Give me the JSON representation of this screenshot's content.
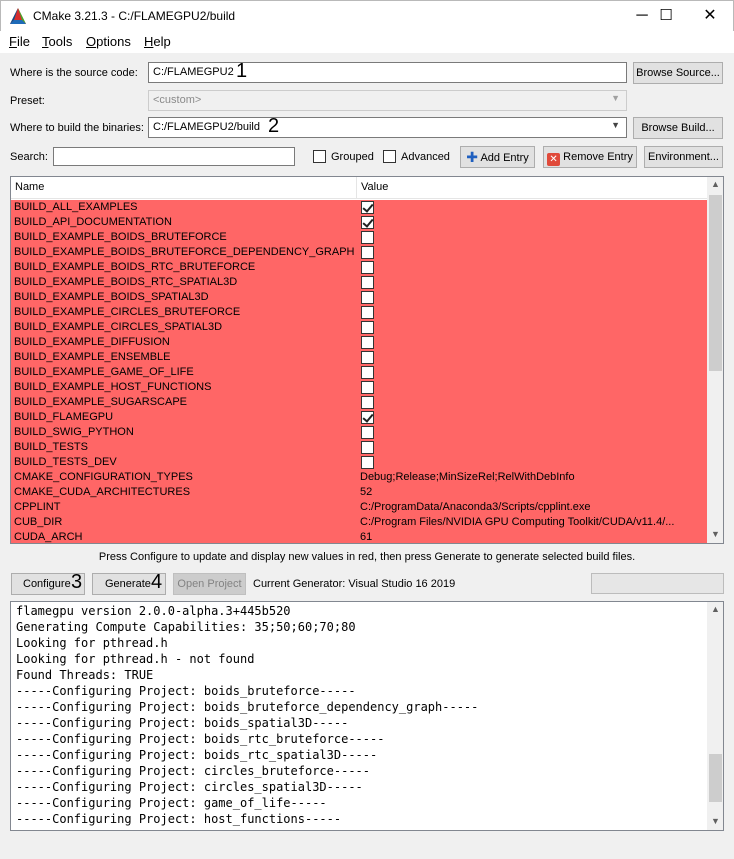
{
  "window": {
    "title": "CMake 3.21.3 - C:/FLAMEGPU2/build",
    "minimize_glyph": "─",
    "maximize_glyph": "☐",
    "close_glyph": "✕"
  },
  "menu": [
    {
      "label": "File",
      "underline": "F"
    },
    {
      "label": "Tools",
      "underline": "T"
    },
    {
      "label": "Options",
      "underline": "O"
    },
    {
      "label": "Help",
      "underline": "H"
    }
  ],
  "source": {
    "label": "Where is the source code:",
    "value": "C:/FLAMEGPU2",
    "annotation": "1",
    "browse_label": "Browse Source..."
  },
  "preset": {
    "label": "Preset:",
    "value": "<custom>"
  },
  "binaries": {
    "label": "Where to build the binaries:",
    "value": "C:/FLAMEGPU2/build",
    "annotation": "2",
    "browse_label": "Browse Build..."
  },
  "search": {
    "label": "Search:",
    "value": "",
    "grouped_label": "Grouped",
    "advanced_label": "Advanced",
    "add_entry_label": "Add Entry",
    "remove_entry_label": "Remove Entry",
    "environment_label": "Environment..."
  },
  "table": {
    "columns": [
      "Name",
      "Value"
    ],
    "rows": [
      {
        "name": "BUILD_ALL_EXAMPLES",
        "type": "bool",
        "checked": true
      },
      {
        "name": "BUILD_API_DOCUMENTATION",
        "type": "bool",
        "checked": true
      },
      {
        "name": "BUILD_EXAMPLE_BOIDS_BRUTEFORCE",
        "type": "bool",
        "checked": false
      },
      {
        "name": "BUILD_EXAMPLE_BOIDS_BRUTEFORCE_DEPENDENCY_GRAPH",
        "type": "bool",
        "checked": false
      },
      {
        "name": "BUILD_EXAMPLE_BOIDS_RTC_BRUTEFORCE",
        "type": "bool",
        "checked": false
      },
      {
        "name": "BUILD_EXAMPLE_BOIDS_RTC_SPATIAL3D",
        "type": "bool",
        "checked": false
      },
      {
        "name": "BUILD_EXAMPLE_BOIDS_SPATIAL3D",
        "type": "bool",
        "checked": false
      },
      {
        "name": "BUILD_EXAMPLE_CIRCLES_BRUTEFORCE",
        "type": "bool",
        "checked": false
      },
      {
        "name": "BUILD_EXAMPLE_CIRCLES_SPATIAL3D",
        "type": "bool",
        "checked": false
      },
      {
        "name": "BUILD_EXAMPLE_DIFFUSION",
        "type": "bool",
        "checked": false
      },
      {
        "name": "BUILD_EXAMPLE_ENSEMBLE",
        "type": "bool",
        "checked": false
      },
      {
        "name": "BUILD_EXAMPLE_GAME_OF_LIFE",
        "type": "bool",
        "checked": false
      },
      {
        "name": "BUILD_EXAMPLE_HOST_FUNCTIONS",
        "type": "bool",
        "checked": false
      },
      {
        "name": "BUILD_EXAMPLE_SUGARSCAPE",
        "type": "bool",
        "checked": false
      },
      {
        "name": "BUILD_FLAMEGPU",
        "type": "bool",
        "checked": true
      },
      {
        "name": "BUILD_SWIG_PYTHON",
        "type": "bool",
        "checked": false
      },
      {
        "name": "BUILD_TESTS",
        "type": "bool",
        "checked": false
      },
      {
        "name": "BUILD_TESTS_DEV",
        "type": "bool",
        "checked": false
      },
      {
        "name": "CMAKE_CONFIGURATION_TYPES",
        "type": "text",
        "value": "Debug;Release;MinSizeRel;RelWithDebInfo"
      },
      {
        "name": "CMAKE_CUDA_ARCHITECTURES",
        "type": "text",
        "value": "52"
      },
      {
        "name": "CPPLINT",
        "type": "text",
        "value": "C:/ProgramData/Anaconda3/Scripts/cpplint.exe"
      },
      {
        "name": "CUB_DIR",
        "type": "text",
        "value": "C:/Program Files/NVIDIA GPU Computing Toolkit/CUDA/v11.4/..."
      },
      {
        "name": "CUDA_ARCH",
        "type": "text",
        "value": "61"
      }
    ]
  },
  "hint": "Press Configure to update and display new values in red, then press Generate to generate selected build files.",
  "actions": {
    "configure_label": "Configure",
    "configure_annotation": "3",
    "generate_label": "Generate",
    "generate_annotation": "4",
    "open_project_label": "Open Project",
    "current_generator": "Current Generator: Visual Studio 16 2019"
  },
  "output_lines": [
    "flamegpu version 2.0.0-alpha.3+445b520",
    "Generating Compute Capabilities: 35;50;60;70;80",
    "Looking for pthread.h",
    "Looking for pthread.h - not found",
    "Found Threads: TRUE",
    "-----Configuring Project: boids_bruteforce-----",
    "-----Configuring Project: boids_bruteforce_dependency_graph-----",
    "-----Configuring Project: boids_spatial3D-----",
    "-----Configuring Project: boids_rtc_bruteforce-----",
    "-----Configuring Project: boids_rtc_spatial3D-----",
    "-----Configuring Project: circles_bruteforce-----",
    "-----Configuring Project: circles_spatial3D-----",
    "-----Configuring Project: game_of_life-----",
    "-----Configuring Project: host_functions-----"
  ],
  "colors": {
    "changed_row": "#ff6666",
    "window_bg": "#f0f0f0"
  },
  "icons": {
    "app": "cmake-triangle-icon",
    "add": "plus-icon",
    "remove": "x-icon"
  }
}
